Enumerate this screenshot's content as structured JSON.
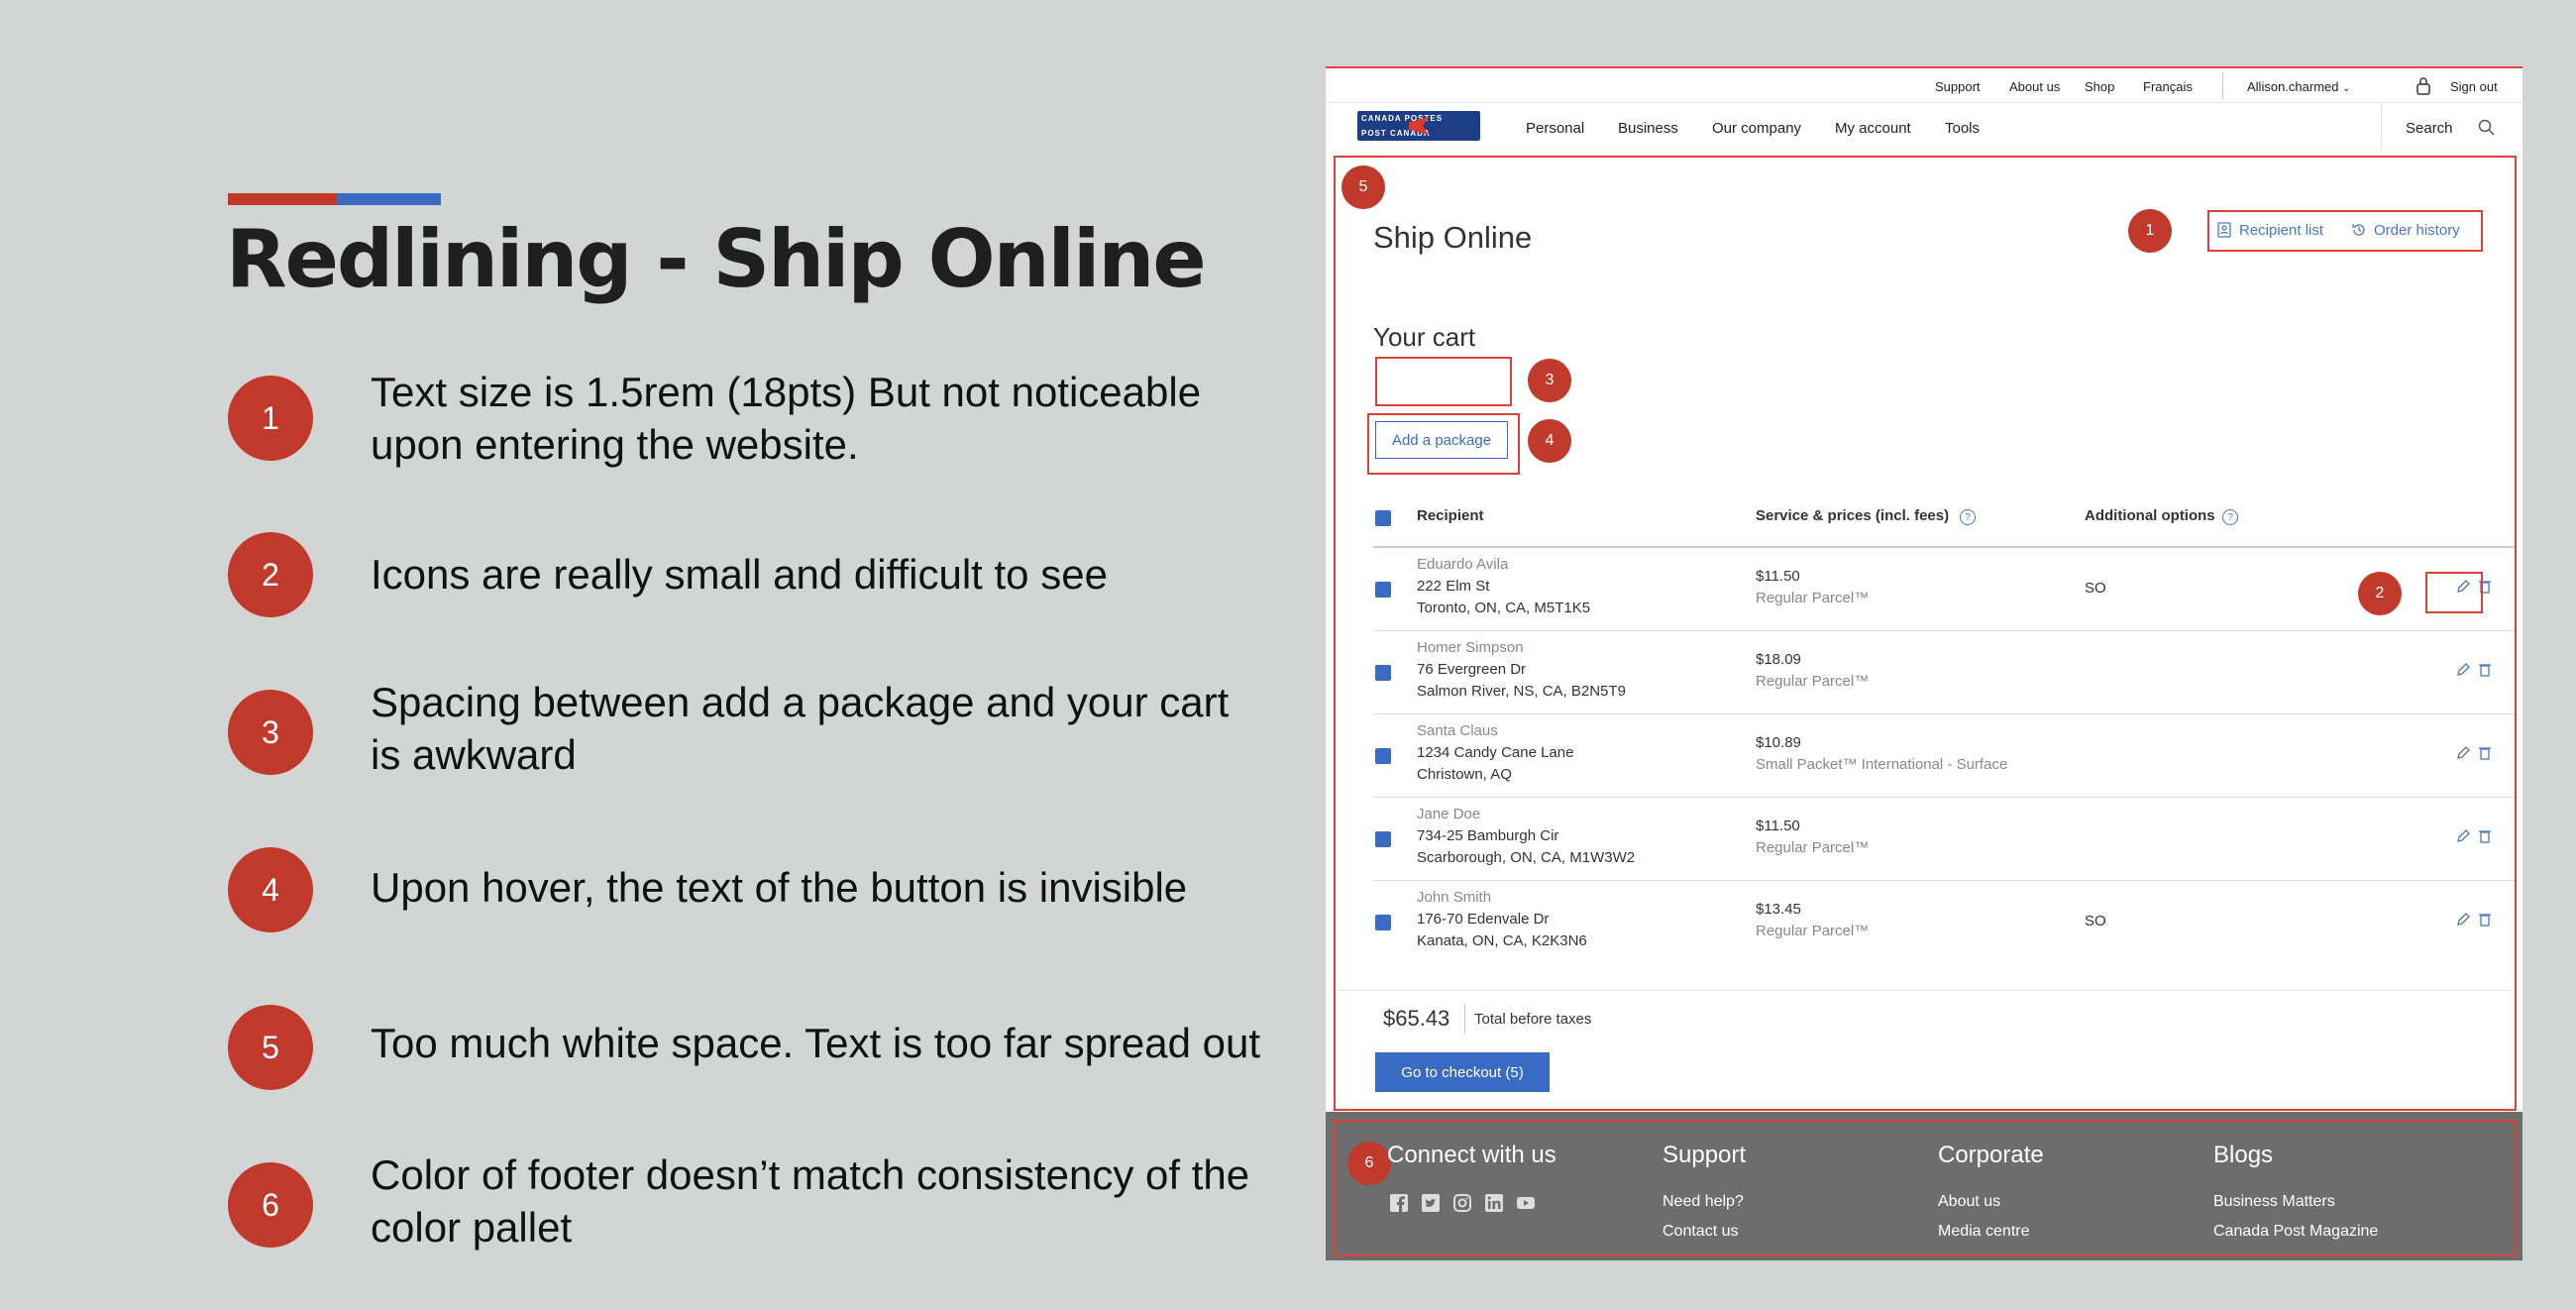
{
  "slide": {
    "title": "Redlining - Ship Online",
    "accent_colors": [
      "#c0392b",
      "#3a6bc4"
    ],
    "notes": [
      {
        "num": "1",
        "text": "Text  size is 1.5rem (18pts) But not noticeable upon entering the website."
      },
      {
        "num": "2",
        "text": "Icons are really small and difficult to see"
      },
      {
        "num": "3",
        "text": "Spacing between add a package and your cart is awkward"
      },
      {
        "num": "4",
        "text": "Upon hover,  the text of the button is invisible"
      },
      {
        "num": "5",
        "text": "Too  much white space. Text  is too far spread out"
      },
      {
        "num": "6",
        "text": "Color of footer doesn’t match consistency of the color pallet"
      }
    ]
  },
  "screenshot": {
    "top_links": [
      "Support",
      "About us",
      "Shop",
      "Français"
    ],
    "user": "Allison.charmed",
    "sign_out": "Sign out",
    "logo": {
      "line1": "CANADA   POSTES",
      "line2": "POST   CANADA"
    },
    "nav": [
      "Personal",
      "Business",
      "Our company",
      "My account",
      "Tools"
    ],
    "search": "Search",
    "page_title": "Ship Online",
    "recipient_list": "Recipient list",
    "order_history": "Order history",
    "cart_title": "Your cart",
    "add_package": "Add a package",
    "columns": {
      "recipient": "Recipient",
      "service": "Service & prices (incl. fees)",
      "options": "Additional options"
    },
    "rows": [
      {
        "name": "Eduardo Avila",
        "addr1": "222 Elm St",
        "addr2": "Toronto, ON, CA, M5T1K5",
        "price": "$11.50",
        "service": "Regular Parcel™",
        "option": "SO"
      },
      {
        "name": "Homer Simpson",
        "addr1": "76 Evergreen Dr",
        "addr2": "Salmon River, NS, CA, B2N5T9",
        "price": "$18.09",
        "service": "Regular Parcel™",
        "option": ""
      },
      {
        "name": "Santa Claus",
        "addr1": "1234 Candy Cane Lane",
        "addr2": "Christown, AQ",
        "price": "$10.89",
        "service": "Small Packet™ International - Surface",
        "option": ""
      },
      {
        "name": "Jane Doe",
        "addr1": "734-25 Bamburgh Cir",
        "addr2": "Scarborough, ON, CA, M1W3W2",
        "price": "$11.50",
        "service": "Regular Parcel™",
        "option": ""
      },
      {
        "name": "John Smith",
        "addr1": "176-70 Edenvale Dr",
        "addr2": "Kanata, ON, CA, K2K3N6",
        "price": "$13.45",
        "service": "Regular Parcel™",
        "option": "SO"
      }
    ],
    "total": "$65.43",
    "total_label": "Total before taxes",
    "checkout": "Go to checkout (5)",
    "footer": {
      "connect": "Connect with us",
      "support": {
        "title": "Support",
        "links": [
          "Need help?",
          "Contact us"
        ]
      },
      "corporate": {
        "title": "Corporate",
        "links": [
          "About us",
          "Media centre"
        ]
      },
      "blogs": {
        "title": "Blogs",
        "links": [
          "Business Matters",
          "Canada Post Magazine"
        ]
      }
    },
    "callouts": [
      "1",
      "2",
      "3",
      "4",
      "5",
      "6"
    ],
    "colors": {
      "brand_blue": "#3a6bc4",
      "redline": "#d9443a",
      "footer_gray": "#6d6d6d"
    }
  }
}
